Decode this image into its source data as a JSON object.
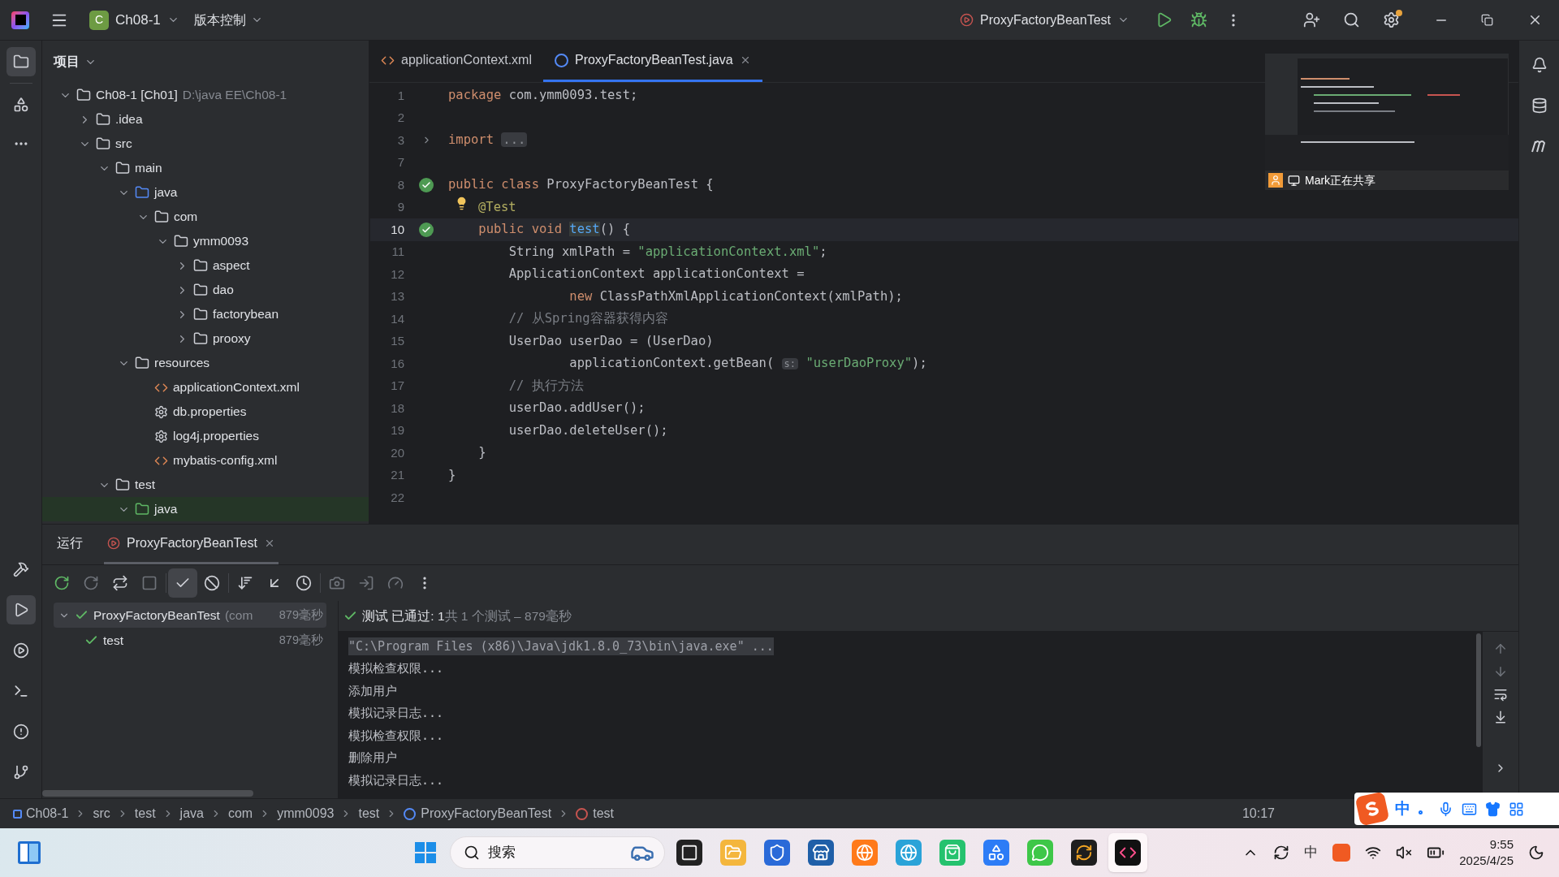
{
  "title_bar": {
    "project_badge": "C",
    "project": "Ch08-1",
    "vcs": "版本控制",
    "run_config": "ProxyFactoryBeanTest"
  },
  "project_panel": {
    "title": "项目",
    "tree": [
      {
        "label": "Ch08-1 [Ch01]",
        "detail": "D:\\java EE\\Ch08-1",
        "kind": "module",
        "expanded": true,
        "children": [
          {
            "label": ".idea",
            "kind": "folder",
            "expanded": false
          },
          {
            "label": "src",
            "kind": "folder",
            "expanded": true,
            "children": [
              {
                "label": "main",
                "kind": "folder",
                "expanded": true,
                "children": [
                  {
                    "label": "java",
                    "kind": "source",
                    "expanded": true,
                    "children": [
                      {
                        "label": "com",
                        "kind": "package",
                        "expanded": true,
                        "children": [
                          {
                            "label": "ymm0093",
                            "kind": "package",
                            "expanded": true,
                            "children": [
                              {
                                "label": "aspect",
                                "kind": "package",
                                "expanded": false
                              },
                              {
                                "label": "dao",
                                "kind": "package",
                                "expanded": false
                              },
                              {
                                "label": "factorybean",
                                "kind": "package",
                                "expanded": false
                              },
                              {
                                "label": "prooxy",
                                "kind": "package",
                                "expanded": false
                              }
                            ]
                          }
                        ]
                      }
                    ]
                  },
                  {
                    "label": "resources",
                    "kind": "resources",
                    "expanded": true,
                    "children": [
                      {
                        "label": "applicationContext.xml",
                        "kind": "spring_xml"
                      },
                      {
                        "label": "db.properties",
                        "kind": "properties"
                      },
                      {
                        "label": "log4j.properties",
                        "kind": "properties"
                      },
                      {
                        "label": "mybatis-config.xml",
                        "kind": "xml"
                      }
                    ]
                  }
                ]
              },
              {
                "label": "test",
                "kind": "folder",
                "expanded": true,
                "children": [
                  {
                    "label": "java",
                    "kind": "test_root",
                    "expanded": true
                  }
                ]
              }
            ]
          }
        ]
      }
    ]
  },
  "editor": {
    "tabs": [
      {
        "label": "applicationContext.xml",
        "kind": "xml",
        "selected": false
      },
      {
        "label": "ProxyFactoryBeanTest.java",
        "kind": "class",
        "selected": true
      }
    ],
    "lines": [
      {
        "number": "1",
        "kind": "plain",
        "current": false,
        "tokens": [
          {
            "kind": "keyword",
            "text": "package "
          },
          {
            "kind": "plain",
            "text": "com.ymm0093.test;"
          }
        ]
      },
      {
        "number": "2",
        "kind": "plain",
        "current": false
      },
      {
        "number": "3",
        "kind": "fold",
        "current": false,
        "tokens": [
          {
            "kind": "keyword",
            "text": "import "
          },
          {
            "kind": "folded",
            "text": "..."
          }
        ]
      },
      {
        "number": "7",
        "kind": "plain",
        "current": false
      },
      {
        "number": "8",
        "kind": "run",
        "current": false,
        "tokens": [
          {
            "kind": "keyword",
            "text": "public class "
          },
          {
            "kind": "plain",
            "text": "ProxyFactoryBeanTest {"
          }
        ]
      },
      {
        "number": "9",
        "kind": "bulb",
        "current": false,
        "tokens": [
          {
            "kind": "annotation",
            "text": "@Test"
          }
        ]
      },
      {
        "number": "10",
        "kind": "run",
        "current": true,
        "tokens": [
          {
            "kind": "keyword",
            "text": "    public void "
          },
          {
            "kind": "function",
            "text": "test"
          },
          {
            "kind": "plain",
            "text": "() {"
          }
        ]
      },
      {
        "number": "11",
        "kind": "plain",
        "current": false,
        "tokens": [
          {
            "kind": "plain",
            "text": "        String xmlPath = "
          },
          {
            "kind": "string",
            "text": "\"applicationContext.xml\""
          },
          {
            "kind": "plain",
            "text": ";"
          }
        ]
      },
      {
        "number": "12",
        "kind": "plain",
        "current": false,
        "tokens": [
          {
            "kind": "plain",
            "text": "        ApplicationContext applicationContext ="
          }
        ]
      },
      {
        "number": "13",
        "kind": "plain",
        "current": false,
        "tokens": [
          {
            "kind": "keyword",
            "text": "                new "
          },
          {
            "kind": "plain",
            "text": "ClassPathXmlApplicationContext(xmlPath);"
          }
        ]
      },
      {
        "number": "14",
        "kind": "plain",
        "current": false,
        "tokens": [
          {
            "kind": "comment",
            "text": "        // 从Spring容器获得内容"
          }
        ]
      },
      {
        "number": "15",
        "kind": "plain",
        "current": false,
        "tokens": [
          {
            "kind": "plain",
            "text": "        UserDao userDao = (UserDao)"
          }
        ]
      },
      {
        "number": "16",
        "kind": "plain",
        "current": false,
        "tokens": [
          {
            "kind": "plain",
            "text": "                applicationContext.getBean( "
          },
          {
            "kind": "hint",
            "text": "s:"
          },
          {
            "kind": "string",
            "text": " \"userDaoProxy\""
          },
          {
            "kind": "plain",
            "text": ");"
          }
        ]
      },
      {
        "number": "17",
        "kind": "plain",
        "current": false,
        "tokens": [
          {
            "kind": "comment",
            "text": "        // 执行方法"
          }
        ]
      },
      {
        "number": "18",
        "kind": "plain",
        "current": false,
        "tokens": [
          {
            "kind": "plain",
            "text": "        userDao.addUser();"
          }
        ]
      },
      {
        "number": "19",
        "kind": "plain",
        "current": false,
        "tokens": [
          {
            "kind": "plain",
            "text": "        userDao.deleteUser();"
          }
        ]
      },
      {
        "number": "20",
        "kind": "plain",
        "current": false,
        "tokens": [
          {
            "kind": "plain",
            "text": "    }"
          }
        ]
      },
      {
        "number": "21",
        "kind": "plain",
        "current": false,
        "tokens": [
          {
            "kind": "plain",
            "text": "}"
          }
        ]
      },
      {
        "number": "22",
        "kind": "plain",
        "current": false
      }
    ],
    "screen_share": {
      "label": "Mark正在共享"
    }
  },
  "run_panel": {
    "tabs": [
      {
        "label": "运行",
        "kind": "title",
        "selected": false
      },
      {
        "label": "ProxyFactoryBeanTest",
        "kind": "config",
        "selected": true
      }
    ],
    "show_passed_selected": true,
    "tests": [
      {
        "name": "ProxyFactoryBeanTest",
        "detail": "(com",
        "time": "879毫秒",
        "selected": true,
        "children": [
          {
            "name": "test",
            "time": "879毫秒",
            "selected": false
          }
        ]
      }
    ],
    "summary": {
      "status": "测试 已通过: 1",
      "details": "共 1 个测试 – 879毫秒"
    },
    "console": [
      {
        "kind": "command",
        "text": "\"C:\\Program Files (x86)\\Java\\jdk1.8.0_73\\bin\\java.exe\" ..."
      },
      {
        "kind": "output",
        "text": "模拟检查权限..."
      },
      {
        "kind": "output",
        "text": "添加用户"
      },
      {
        "kind": "output",
        "text": "模拟记录日志..."
      },
      {
        "kind": "output",
        "text": "模拟检查权限..."
      },
      {
        "kind": "output",
        "text": "删除用户"
      },
      {
        "kind": "output",
        "text": "模拟记录日志..."
      }
    ]
  },
  "status_bar": {
    "breadcrumbs": [
      {
        "label": "Ch08-1",
        "kind": "module"
      },
      {
        "label": "src",
        "kind": "folder"
      },
      {
        "label": "test",
        "kind": "folder"
      },
      {
        "label": "java",
        "kind": "folder"
      },
      {
        "label": "com",
        "kind": "folder"
      },
      {
        "label": "ymm0093",
        "kind": "folder"
      },
      {
        "label": "test",
        "kind": "folder"
      },
      {
        "label": "ProxyFactoryBeanTest",
        "kind": "class"
      },
      {
        "label": "test",
        "kind": "method"
      }
    ],
    "position": "10:17"
  },
  "ime_bar": {
    "mode": "中"
  },
  "taskbar": {
    "search_placeholder": "搜索",
    "tray_ime": "中",
    "time": "9:55",
    "date": "2025/4/25"
  }
}
